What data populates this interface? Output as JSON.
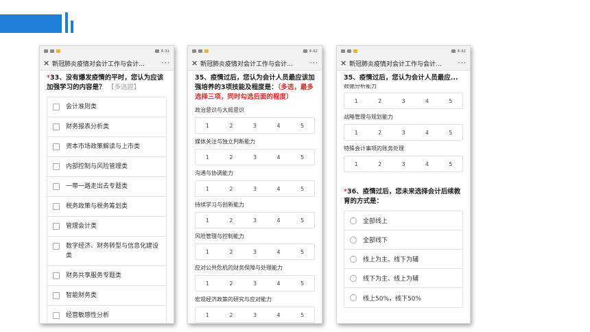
{
  "phones": [
    {
      "status_time": "4:31",
      "title": "新冠肺炎疫情对会计工作与会计...",
      "more_label": "···",
      "question": {
        "star": "*",
        "text": "33、没有爆发疫情的平时，您认为应该加强学习的内容是？",
        "hint": "【多选题】"
      },
      "options": [
        "会计准则类",
        "财务报表分析类",
        "资本市场政策解读与上市类",
        "内部控制与风险管理类",
        "一带一路走出去专题类",
        "税务政策与税务筹划类",
        "管理会计类",
        "数字经济、财务转型与信息化建设类",
        "财务共享服务专题类",
        "智能财务类",
        "经营敏感性分析"
      ]
    },
    {
      "status_time": "4:32",
      "title": "新冠肺炎疫情对会计工作与会计...",
      "more_label": "···",
      "question": {
        "text": "35、疫情过后，您认为会计人员最应该加强培养的3项技能及程度是：",
        "red": "（多选，最多选择三项，同时勾选后面的程度）"
      },
      "scale": [
        "1",
        "2",
        "3",
        "4",
        "5"
      ],
      "items": [
        "政治意识与大局意识",
        "媒体关注与独立判断能力",
        "沟通与协调能力",
        "持续学习与创新能力",
        "风险管理与控制能力",
        "应对公共危机的财务保障与处理能力",
        "宏观经济政策的研究与应对能力"
      ]
    },
    {
      "status_time": "4:32",
      "title": "新冠肺炎疫情对会计工作与会计...",
      "more_label": "···",
      "sticky": "35、疫情过后，您认为会计人员最应...",
      "cut_label": "数据分析能力",
      "scale": [
        "1",
        "2",
        "3",
        "4",
        "5"
      ],
      "items": [
        "战略管理与规划能力",
        "特殊会计事项的账务处理"
      ],
      "question36": {
        "star": "*",
        "text": "36、疫情过后，您未来选择会计后续教育的方式是："
      },
      "radio_options": [
        "全部线上",
        "全部线下",
        "线上为主、线下为辅",
        "线下为主、线上为辅",
        "线上50%，线下50%"
      ]
    }
  ],
  "colors": {
    "accent": "#1f7fd6",
    "required": "#e53935",
    "emphasis": "#d32f2f"
  }
}
